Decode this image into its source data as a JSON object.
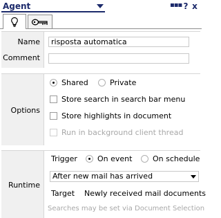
{
  "panel": {
    "title": "Agent",
    "icons": {
      "menu": "grip-dots-icon",
      "help": "?",
      "close": "x"
    }
  },
  "tabs": [
    {
      "label": "",
      "icon": "lightbulb-icon",
      "active": true
    },
    {
      "label": "",
      "icon": "key-icon",
      "active": false
    }
  ],
  "basics": {
    "name_label": "Name",
    "name_value": "risposta automatica",
    "comment_label": "Comment",
    "comment_value": ""
  },
  "options": {
    "section_label": "Options",
    "shared_label": "Shared",
    "private_label": "Private",
    "selected_visibility": "Shared",
    "store_search_label": "Store search in search bar menu",
    "store_highlights_label": "Store highlights in document",
    "run_background_label": "Run in background client thread"
  },
  "runtime": {
    "section_label": "Runtime",
    "trigger_label": "Trigger",
    "on_event_label": "On event",
    "on_schedule_label": "On schedule",
    "selected_trigger": "On event",
    "event_select_value": "After new mail has arrived",
    "target_label": "Target",
    "target_value": "Newly received mail documents",
    "footer_note": "Searches may be set via Document Selection"
  }
}
